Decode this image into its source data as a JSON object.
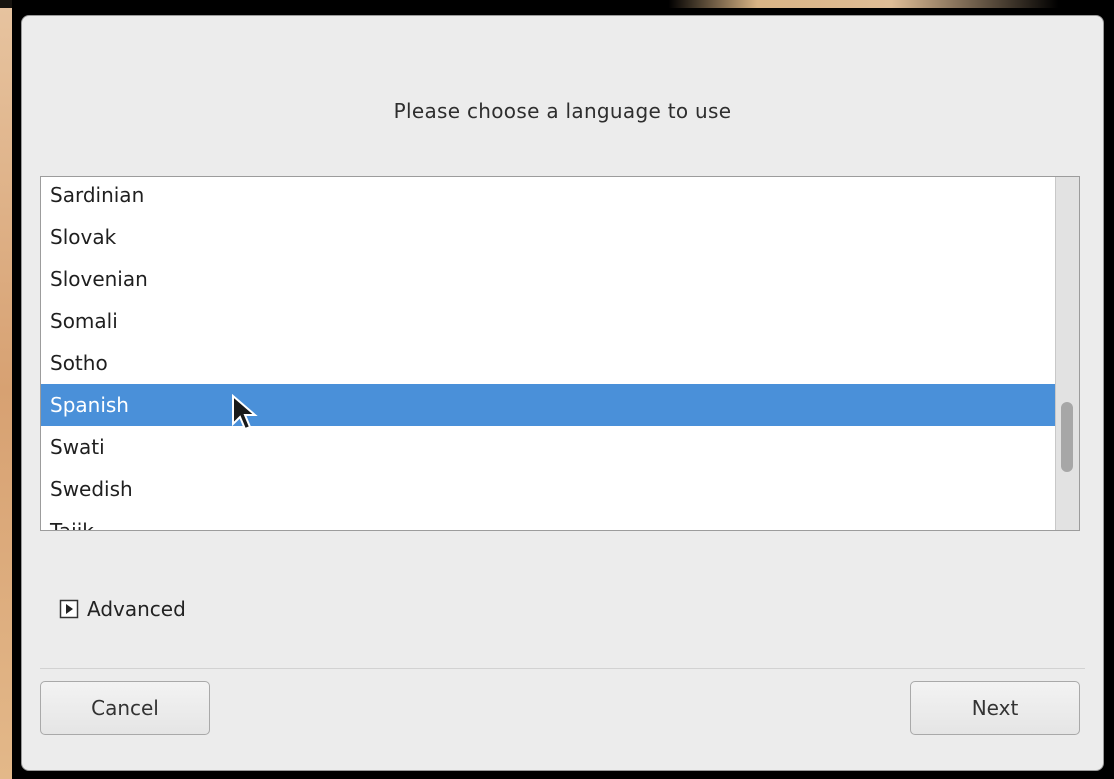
{
  "dialog": {
    "title": "Please choose a language to use"
  },
  "language_list": {
    "items": [
      {
        "label": "Sardinian",
        "selected": false
      },
      {
        "label": "Slovak",
        "selected": false
      },
      {
        "label": "Slovenian",
        "selected": false
      },
      {
        "label": "Somali",
        "selected": false
      },
      {
        "label": "Sotho",
        "selected": false
      },
      {
        "label": "Spanish",
        "selected": true
      },
      {
        "label": "Swati",
        "selected": false
      },
      {
        "label": "Swedish",
        "selected": false
      },
      {
        "label": "Tajik",
        "selected": false
      }
    ],
    "selected_color": "#4a90d9"
  },
  "advanced": {
    "label": "Advanced",
    "icon": "expander-right-icon",
    "expanded": false
  },
  "buttons": {
    "cancel_label": "Cancel",
    "next_label": "Next"
  }
}
